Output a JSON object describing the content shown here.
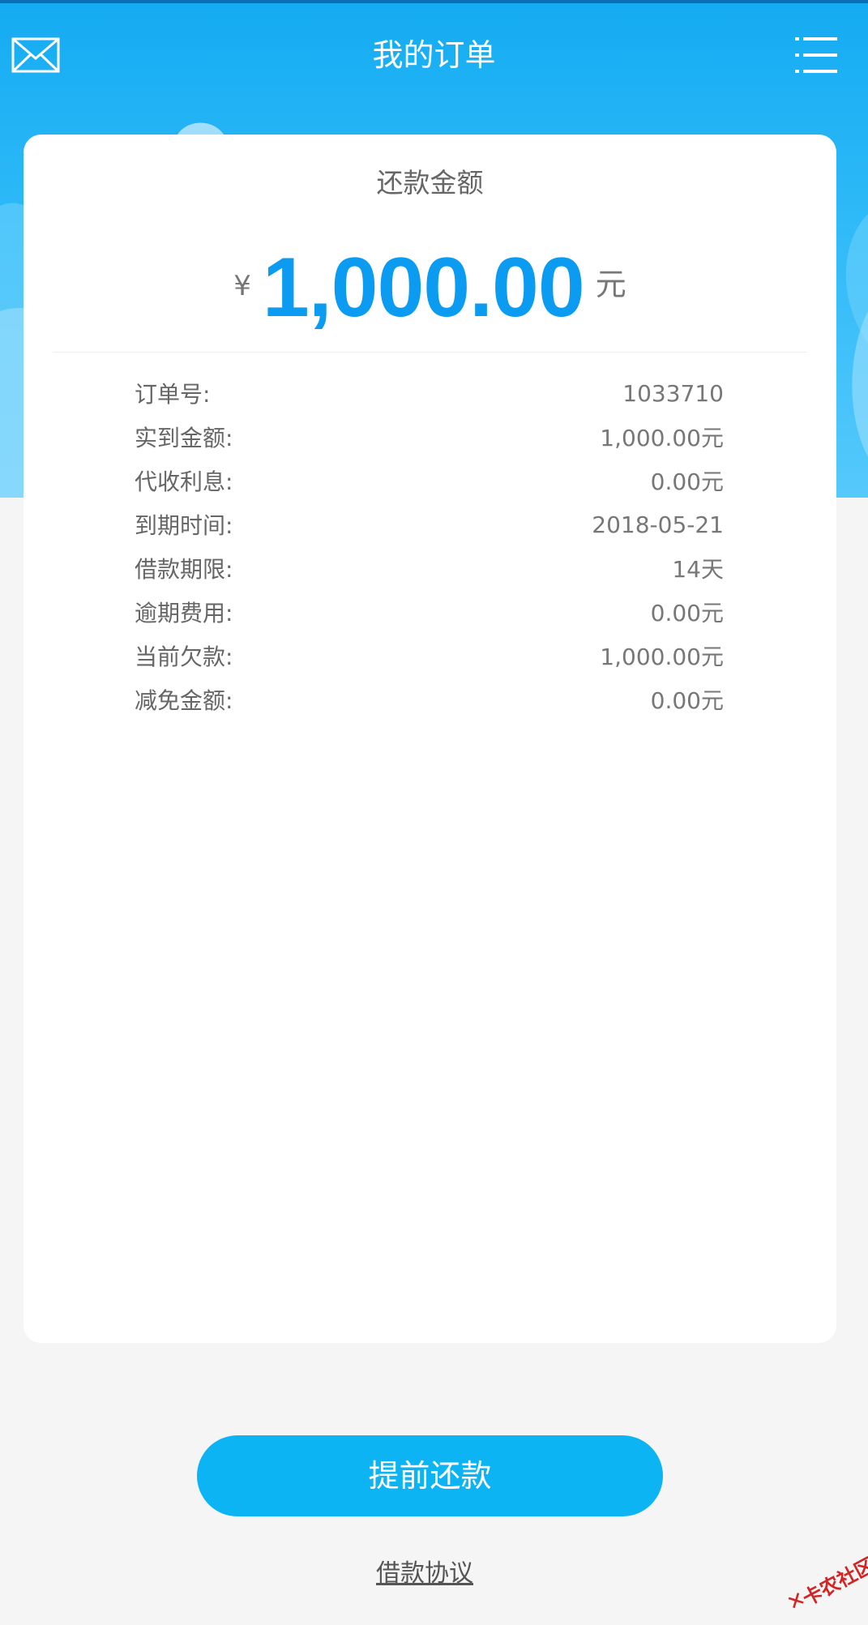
{
  "header": {
    "title": "我的订单",
    "left_icon": "mail-icon",
    "right_icon": "menu-list-icon"
  },
  "summary": {
    "label": "还款金额",
    "currency_symbol": "¥",
    "amount": "1,000.00",
    "unit": "元"
  },
  "details": [
    {
      "label": "订单号:",
      "value": "1033710"
    },
    {
      "label": "实到金额:",
      "value": "1,000.00元"
    },
    {
      "label": "代收利息:",
      "value": "0.00元"
    },
    {
      "label": "到期时间:",
      "value": "2018-05-21"
    },
    {
      "label": "借款期限:",
      "value": "14天"
    },
    {
      "label": "逾期费用:",
      "value": "0.00元"
    },
    {
      "label": "当前欠款:",
      "value": "1,000.00元"
    },
    {
      "label": "减免金额:",
      "value": "0.00元"
    }
  ],
  "actions": {
    "repay_label": "提前还款",
    "agreement_label": "借款协议"
  },
  "watermark": {
    "text": "卡农社区"
  },
  "colors": {
    "header_blue": "#14abf2",
    "amount_blue": "#0b9bf0",
    "button_blue": "#0cb4f3",
    "background": "#f5f5f5"
  }
}
